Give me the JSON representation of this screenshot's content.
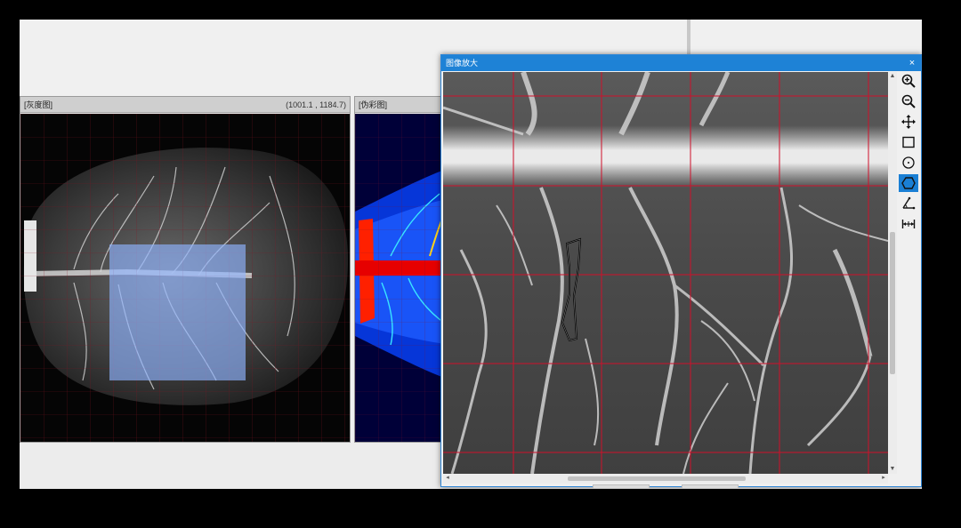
{
  "gray_panel": {
    "title": "[灰度图]",
    "coords": "(1001.1 , 1184.7)"
  },
  "pseudo_panel": {
    "title": "[伪彩图]"
  },
  "zoom_dialog": {
    "title": "图像放大",
    "close_glyph": "×",
    "v_scroll_up": "▲",
    "v_scroll_down": "▼",
    "h_scroll_left": "◂",
    "h_scroll_right": "▸"
  },
  "toolbar": {
    "tools": [
      {
        "name": "zoom-in",
        "icon": "zoom-in-icon"
      },
      {
        "name": "zoom-out",
        "icon": "zoom-out-icon"
      },
      {
        "name": "pan",
        "icon": "move-icon"
      },
      {
        "name": "rectangle",
        "icon": "rectangle-icon"
      },
      {
        "name": "circle",
        "icon": "circle-icon"
      },
      {
        "name": "polygon",
        "icon": "polygon-icon",
        "active": true
      },
      {
        "name": "angle",
        "icon": "angle-icon"
      },
      {
        "name": "distance",
        "icon": "measure-distance-icon"
      }
    ]
  },
  "colors": {
    "grid": "#c8102e",
    "selection": "#8fb3ff",
    "titlebar": "#1e82d6",
    "active_tool": "#1a7fd4"
  }
}
